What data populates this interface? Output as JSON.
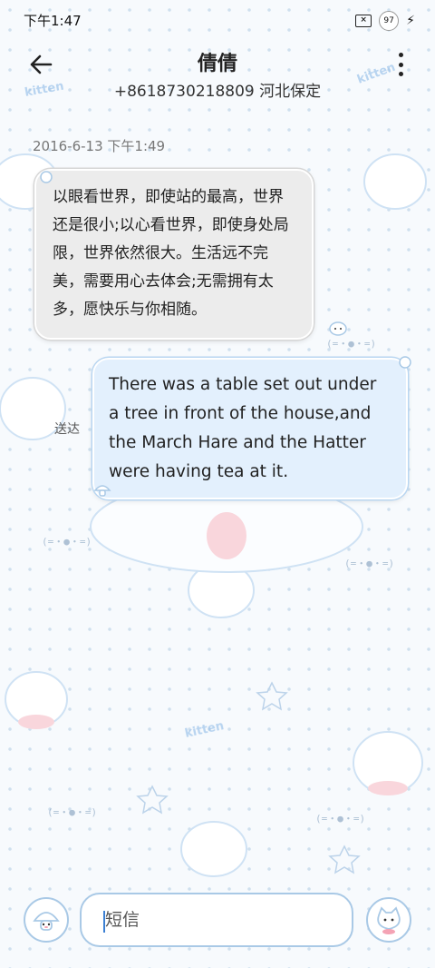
{
  "status_bar": {
    "time": "下午1:47",
    "battery": "97",
    "sim_label": "×"
  },
  "header": {
    "contact_name": "倩倩",
    "contact_detail": "+8618730218809 河北保定"
  },
  "conversation": {
    "timestamp": "2016-6-13 下午1:49",
    "messages": [
      {
        "direction": "incoming",
        "text": "以眼看世界，即使站的最高，世界还是很小;以心看世界，即使身处局限，世界依然很大。生活远不完美，需要用心去体会;无需拥有太多，愿快乐与你相随。"
      },
      {
        "direction": "outgoing",
        "text": "There was a table set out under a tree in front of the house,and the March Hare and the Hatter were having tea at it.",
        "status": "送达"
      }
    ]
  },
  "compose": {
    "placeholder": "短信"
  },
  "colors": {
    "incoming_bubble": "#ececec",
    "outgoing_bubble": "#e3f0fd",
    "accent_border": "#a9c9e6"
  },
  "icons": {
    "back": "arrow-left-icon",
    "more": "more-vertical-icon",
    "charging": "lightning-icon",
    "sim": "sim-off-icon"
  }
}
